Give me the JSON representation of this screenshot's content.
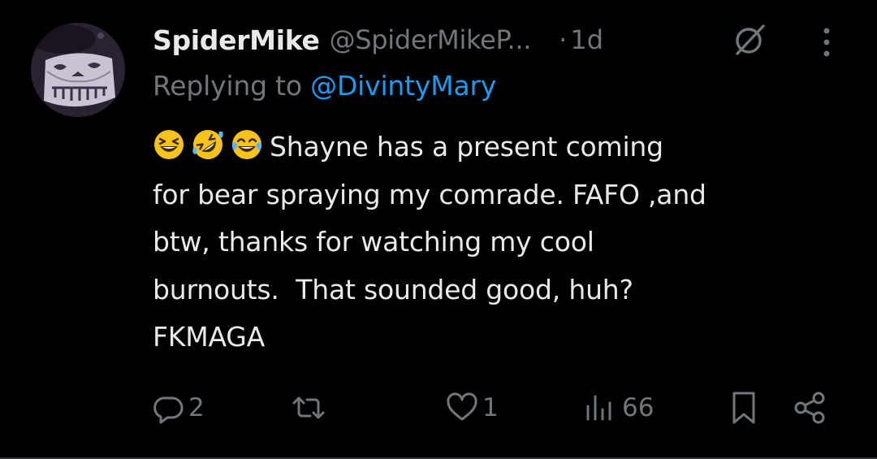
{
  "tweet": {
    "display_name": "SpiderMike",
    "handle": "@SpiderMikeP...",
    "separator": "·",
    "time": "1d",
    "replying_prefix": "Replying to ",
    "replying_mention": "@DivintyMary",
    "emojis": [
      "grinning-squinting-face",
      "rolling-on-the-floor-laughing",
      "face-with-tears-of-joy"
    ],
    "body_lines": [
      "Shayne has a present coming",
      "for bear spraying my comrade. FAFO ,and",
      "btw, thanks for watching my cool",
      "burnouts.  That sounded good, huh?",
      "FKMAGA"
    ]
  },
  "actions": {
    "replies": "2",
    "retweets": "",
    "likes": "1",
    "views": "66"
  },
  "icons": {
    "reply": "reply-bubble-icon",
    "retweet": "retweet-icon",
    "like": "heart-icon",
    "views": "views-bars-icon",
    "bookmark": "bookmark-icon",
    "share": "share-icon",
    "more": "more-vertical-icon",
    "grok": "grok-slash-circle-icon"
  },
  "colors": {
    "background": "#000000",
    "primary_text": "#e7e9ea",
    "secondary_text": "#71767b",
    "accent": "#1d9bf0"
  }
}
